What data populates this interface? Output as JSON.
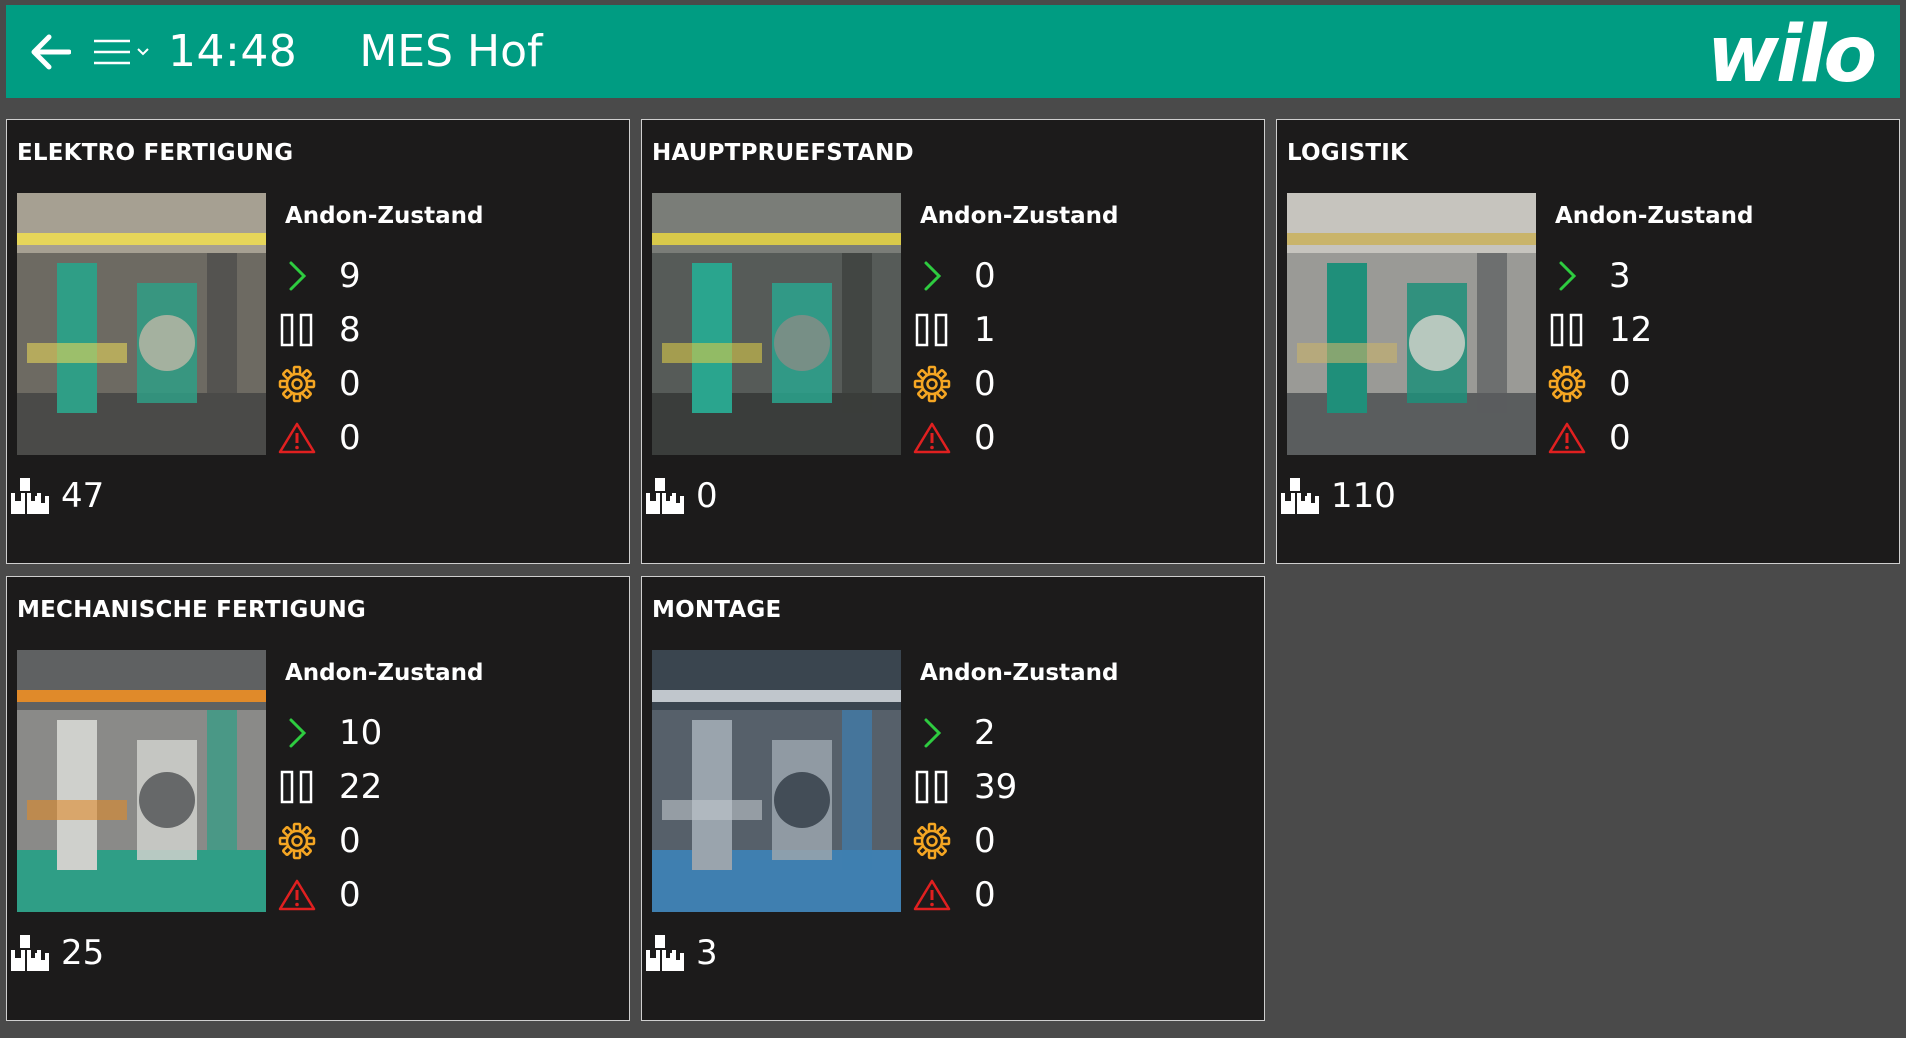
{
  "header": {
    "clock": "14:48",
    "title": "MES Hof",
    "logo_text": "wilo",
    "back_icon": "arrow-left-icon",
    "menu_icon": "hamburger-menu-icon",
    "accent_color": "#009c82"
  },
  "status_legend": {
    "running_icon": "chevron-right-icon",
    "paused_icon": "pause-icon",
    "maintenance_icon": "gear-icon",
    "error_icon": "warning-triangle-icon",
    "orders_icon": "parts-stack-icon",
    "colors": {
      "running": "#2ecc40",
      "paused": "#ffffff",
      "maintenance": "#f5a623",
      "error": "#e02020"
    }
  },
  "cards": [
    {
      "title": "ELEKTRO FERTIGUNG",
      "andon_label": "Andon-Zustand",
      "running": "9",
      "paused": "8",
      "maintenance": "0",
      "error": "0",
      "orders": "47"
    },
    {
      "title": "HAUPTPRUEFSTAND",
      "andon_label": "Andon-Zustand",
      "running": "0",
      "paused": "1",
      "maintenance": "0",
      "error": "0",
      "orders": "0"
    },
    {
      "title": "LOGISTIK",
      "andon_label": "Andon-Zustand",
      "running": "3",
      "paused": "12",
      "maintenance": "0",
      "error": "0",
      "orders": "110"
    },
    {
      "title": "MECHANISCHE FERTIGUNG",
      "andon_label": "Andon-Zustand",
      "running": "10",
      "paused": "22",
      "maintenance": "0",
      "error": "0",
      "orders": "25"
    },
    {
      "title": "MONTAGE",
      "andon_label": "Andon-Zustand",
      "running": "2",
      "paused": "39",
      "maintenance": "0",
      "error": "0",
      "orders": "3"
    }
  ]
}
